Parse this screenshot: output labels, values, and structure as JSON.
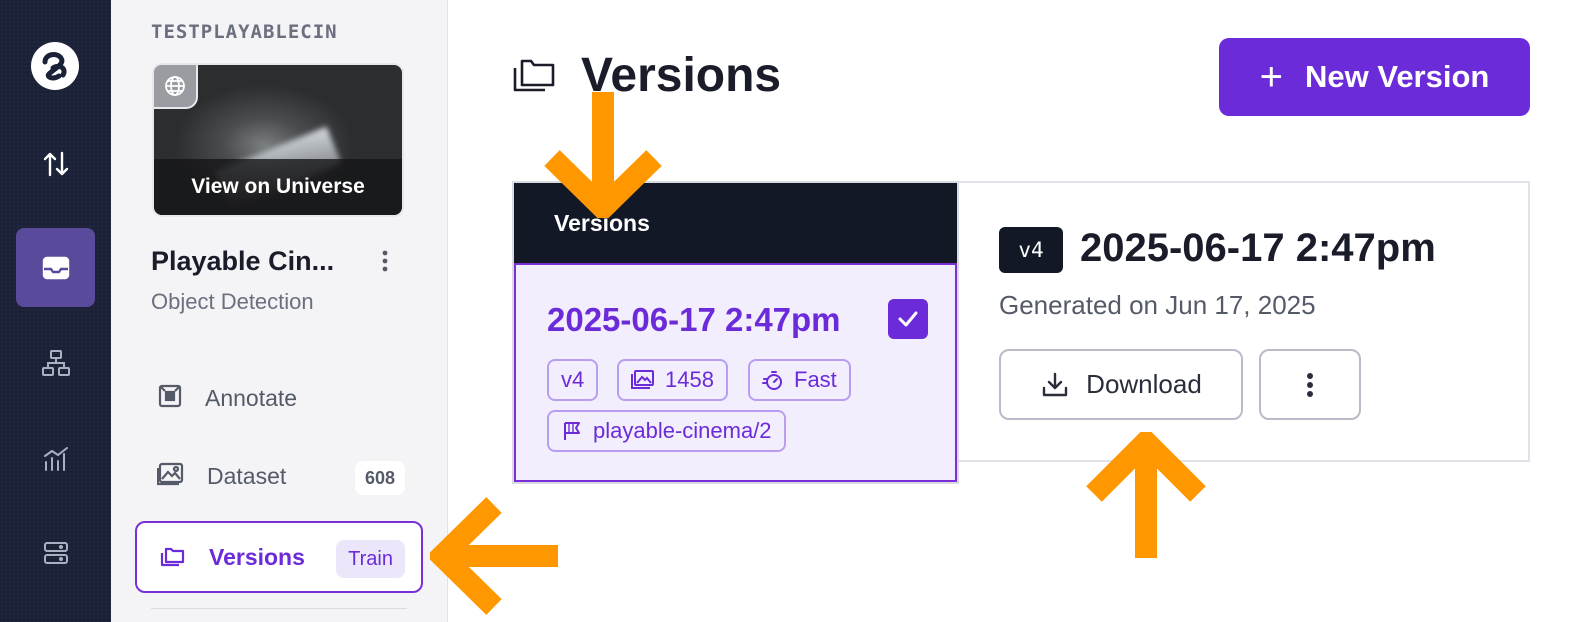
{
  "rail": {
    "items": [
      {
        "icon": "swap-vertical-icon"
      },
      {
        "icon": "inbox-icon",
        "active": true
      },
      {
        "icon": "hierarchy-icon"
      },
      {
        "icon": "analytics-icon"
      },
      {
        "icon": "server-icon"
      }
    ]
  },
  "sidebar": {
    "workspace": "TESTPLAYABLECIN",
    "thumbnail_action": "View on Universe",
    "project_title": "Playable Cin...",
    "project_type": "Object Detection",
    "nav": [
      {
        "label": "Annotate",
        "icon": "annotate-icon"
      },
      {
        "label": "Dataset",
        "icon": "image-icon",
        "count": "608"
      },
      {
        "label": "Versions",
        "icon": "folders-icon",
        "badge": "Train",
        "active": true
      }
    ]
  },
  "main": {
    "title": "Versions",
    "new_version_label": "New Version",
    "list_header": "Versions",
    "selected_version": {
      "date": "2025-06-17 2:47pm",
      "tags": {
        "version": "v4",
        "images": "1458",
        "speed": "Fast",
        "source": "playable-cinema/2"
      }
    },
    "detail": {
      "badge": "v4",
      "title": "2025-06-17 2:47pm",
      "generated": "Generated on Jun 17, 2025",
      "download_label": "Download"
    }
  },
  "colors": {
    "accent": "#6c2bd9",
    "rail_bg": "#1b2137",
    "annotation_arrow": "#ff9800"
  }
}
